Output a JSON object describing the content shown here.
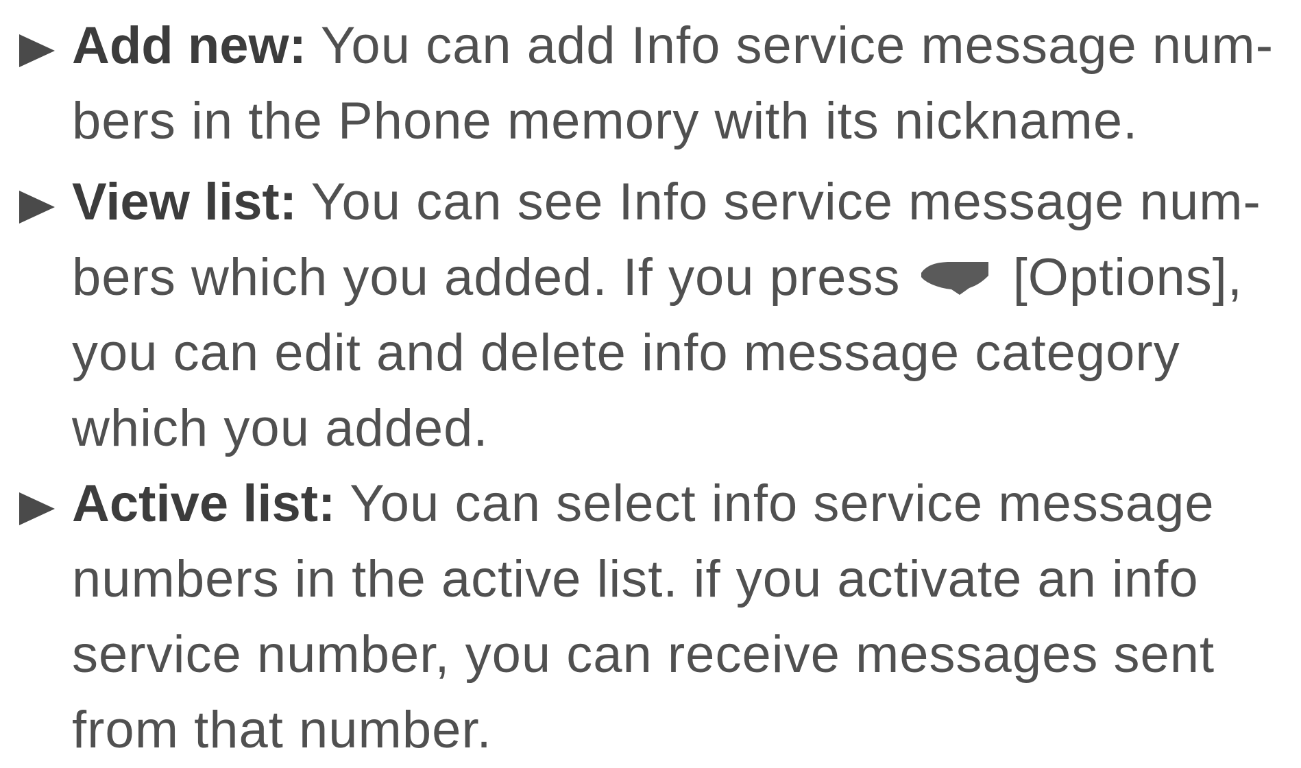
{
  "items": [
    {
      "term": "Add new:",
      "text": " You can add Info service message num-bers in the Phone memory with its nickname."
    },
    {
      "term": "View list:",
      "text_before": " You can see Info service message num-bers which you added. If you press ",
      "key_icon": "left-soft-key-icon",
      "text_after": " [Options], you can edit and delete info message category which you added."
    },
    {
      "term": "Active list:",
      "text": " You can select info service message numbers in the active list. if you activate an info service number, you can receive messages sent from that number."
    }
  ],
  "colors": {
    "text": "#505050",
    "term": "#3c3c3c",
    "bullet": "#4a4a4a"
  }
}
